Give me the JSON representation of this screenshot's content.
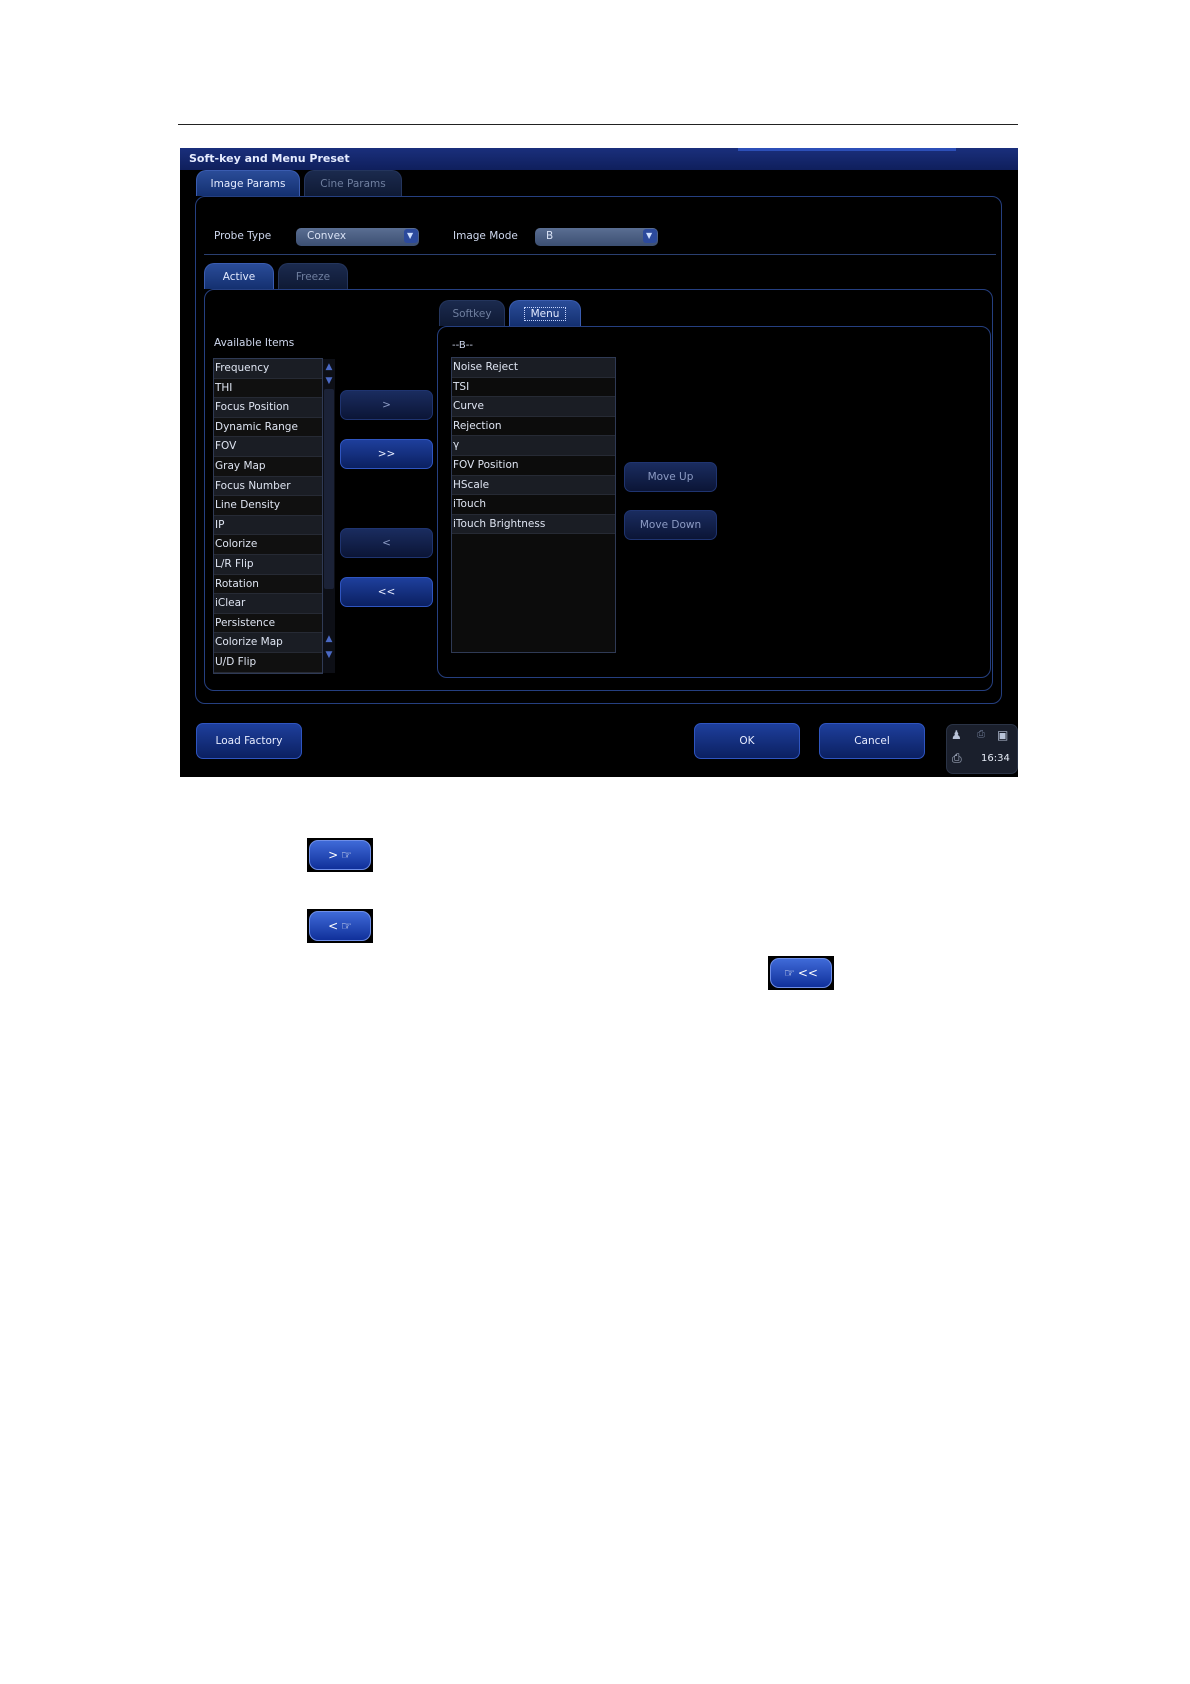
{
  "window": {
    "title": "Soft-key and Menu Preset",
    "top_tabs": [
      "Image Params",
      "Cine Params"
    ],
    "probe_type_label": "Probe Type",
    "probe_type_value": "Convex",
    "image_mode_label": "Image Mode",
    "image_mode_value": "B",
    "mode_tabs": [
      "Active",
      "Freeze"
    ],
    "sub_tabs": [
      "Softkey",
      "Menu"
    ],
    "available_label": "Available Items",
    "available_items": [
      "Frequency",
      "THI",
      "Focus Position",
      "Dynamic Range",
      "FOV",
      "Gray Map",
      "Focus Number",
      "Line Density",
      "IP",
      "Colorize",
      "L/R Flip",
      "Rotation",
      "iClear",
      "Persistence",
      "Colorize Map",
      "U/D Flip"
    ],
    "menu_header": "--B--",
    "menu_items": [
      "Noise Reject",
      "TSI",
      "Curve",
      "Rejection",
      "γ",
      "FOV Position",
      "HScale",
      "iTouch",
      "iTouch Brightness"
    ],
    "transfer_buttons": [
      ">",
      ">>",
      "<",
      "<<"
    ],
    "move_up": "Move Up",
    "move_down": "Move Down",
    "load_factory": "Load Factory",
    "ok": "OK",
    "cancel": "Cancel",
    "time": "16:34"
  },
  "illustrations": [
    ">",
    "<",
    "<<"
  ],
  "colors": {
    "accent": "#1e3f9c",
    "background": "#000000"
  },
  "icons": [
    "hand-cursor-icon",
    "user-icon",
    "printer-icon",
    "monitor-icon",
    "chevron-down-icon"
  ]
}
